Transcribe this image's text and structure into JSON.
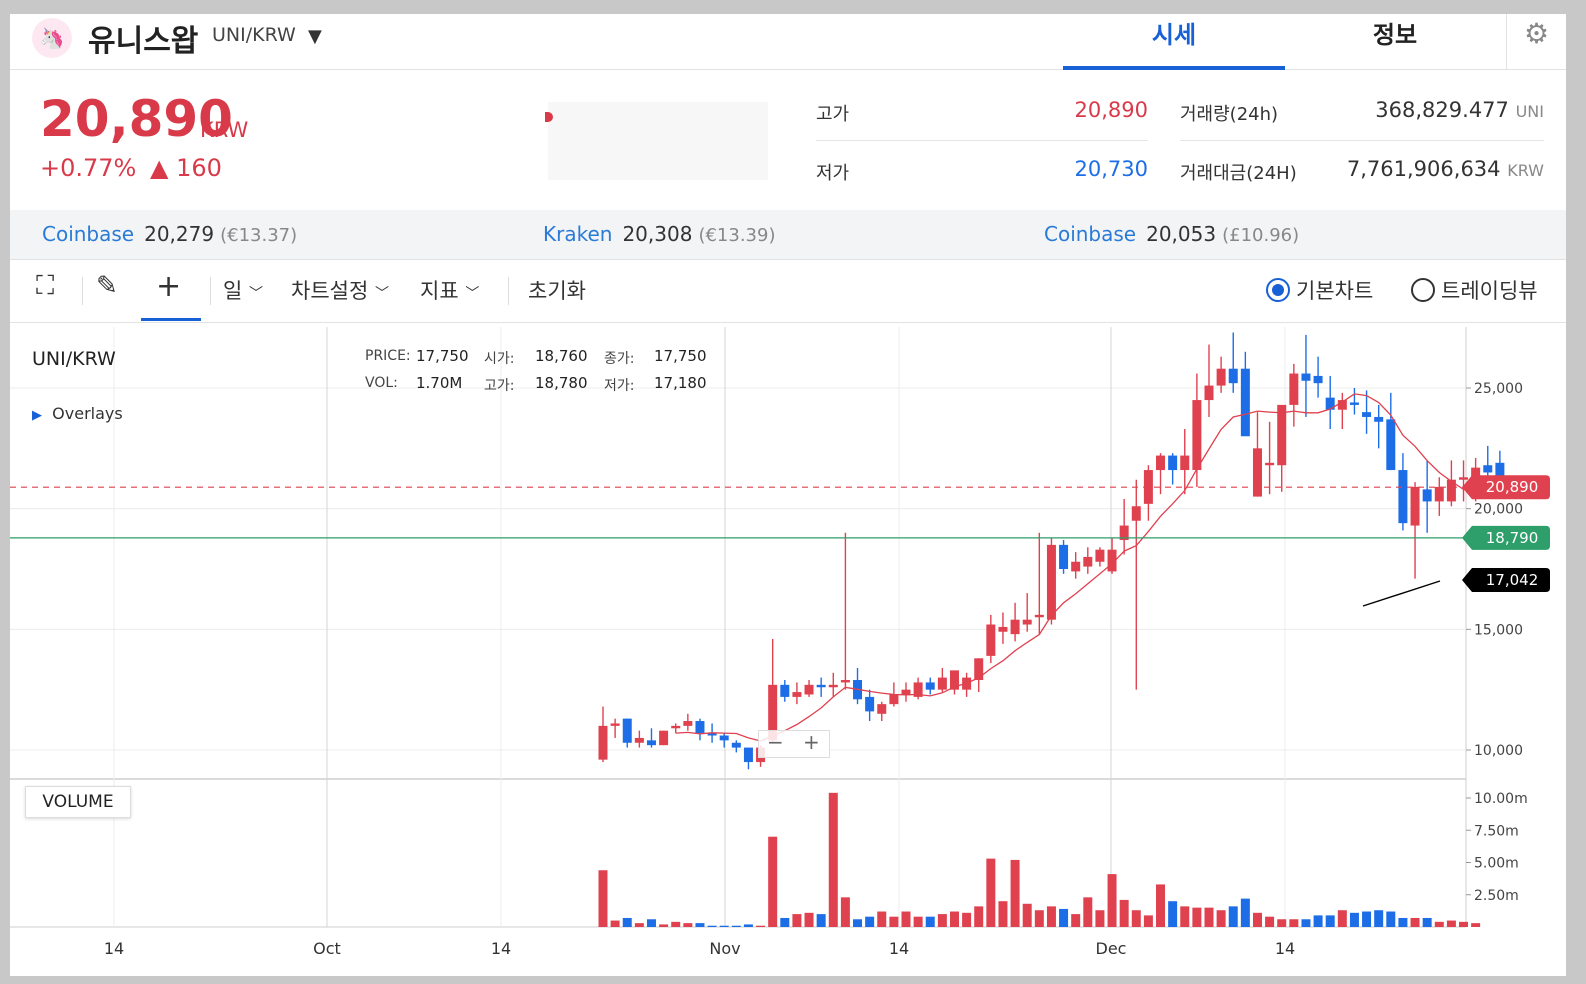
{
  "header": {
    "coin_name": "유니스왑",
    "pair": "UNI/KRW",
    "tabs": [
      {
        "label": "시세"
      },
      {
        "label": "정보"
      }
    ]
  },
  "price": {
    "current": "20,890",
    "currency": "KRW",
    "change_pct": "+0.77%",
    "change_abs": "▲ 160"
  },
  "stats": {
    "high_label": "고가",
    "high_value": "20,890",
    "low_label": "저가",
    "low_value": "20,730",
    "volume_label": "거래량(24h)",
    "volume_value": "368,829.477",
    "volume_unit": "UNI",
    "amount_label": "거래대금(24H)",
    "amount_value": "7,761,906,634",
    "amount_unit": "KRW"
  },
  "exchanges": [
    {
      "name": "Coinbase",
      "price": "20,279",
      "sub": "(€13.37)"
    },
    {
      "name": "Kraken",
      "price": "20,308",
      "sub": "(€13.39)"
    },
    {
      "name": "Coinbase",
      "price": "20,053",
      "sub": "(£10.96)"
    }
  ],
  "toolbar": {
    "period": "일",
    "chart_settings": "차트설정",
    "indicators": "지표",
    "reset": "초기화",
    "basic_chart": "기본차트",
    "tradingview": "트레이딩뷰"
  },
  "chart_info": {
    "symbol": "UNI/KRW",
    "overlays": "Overlays",
    "price_label": "PRICE:",
    "price_value": "17,750",
    "open_label": "시가:",
    "open_value": "18,760",
    "close_label": "종가:",
    "close_value": "17,750",
    "vol_label": "VOL:",
    "vol_value": "1.70M",
    "high_label": "고가:",
    "high_value": "18,780",
    "low_label": "저가:",
    "low_value": "17,180",
    "volume_panel": "VOLUME",
    "zoom_out": "−",
    "zoom_in": "+"
  },
  "colors": {
    "up": "#e0414f",
    "down": "#1d6ee6",
    "accent": "#1760d6",
    "ma": "#e0414f",
    "hline": "#2e9e6a"
  },
  "chart_data": {
    "type": "candlestick",
    "y_ticks": [
      "25,000",
      "20,000",
      "15,000",
      "10,000"
    ],
    "vol_ticks": [
      "10.00m",
      "7.50m",
      "5.00m",
      "2.50m"
    ],
    "x_ticks": [
      "14",
      "Oct",
      "14",
      "Nov",
      "14",
      "Dec",
      "14"
    ],
    "price_lines": [
      {
        "label": "20,890",
        "value": 20890,
        "color": "#e0414f",
        "style": "dashed"
      },
      {
        "label": "18,790",
        "value": 18790,
        "color": "#2e9e6a",
        "style": "solid"
      },
      {
        "label": "17,042",
        "value": 17042,
        "color": "#000000",
        "style": "label"
      }
    ],
    "candles": [
      {
        "o": 9600,
        "h": 11800,
        "l": 9500,
        "c": 11000
      },
      {
        "o": 11000,
        "h": 11300,
        "l": 10500,
        "c": 11100
      },
      {
        "o": 11300,
        "h": 11300,
        "l": 10100,
        "c": 10300
      },
      {
        "o": 10300,
        "h": 10800,
        "l": 10100,
        "c": 10500
      },
      {
        "o": 10400,
        "h": 10900,
        "l": 10100,
        "c": 10200
      },
      {
        "o": 10200,
        "h": 10800,
        "l": 10200,
        "c": 10800
      },
      {
        "o": 10900,
        "h": 11100,
        "l": 10700,
        "c": 11000
      },
      {
        "o": 11000,
        "h": 11500,
        "l": 10800,
        "c": 11200
      },
      {
        "o": 11200,
        "h": 11300,
        "l": 10400,
        "c": 10700
      },
      {
        "o": 10700,
        "h": 11100,
        "l": 10300,
        "c": 10600
      },
      {
        "o": 10600,
        "h": 10700,
        "l": 10100,
        "c": 10400
      },
      {
        "o": 10300,
        "h": 10400,
        "l": 9900,
        "c": 10100
      },
      {
        "o": 10100,
        "h": 10100,
        "l": 9200,
        "c": 9500
      },
      {
        "o": 9500,
        "h": 10200,
        "l": 9300,
        "c": 10100
      },
      {
        "o": 10400,
        "h": 14600,
        "l": 10300,
        "c": 12700
      },
      {
        "o": 12700,
        "h": 12900,
        "l": 12000,
        "c": 12200
      },
      {
        "o": 12200,
        "h": 12800,
        "l": 11900,
        "c": 12400
      },
      {
        "o": 12300,
        "h": 12900,
        "l": 12200,
        "c": 12700
      },
      {
        "o": 12700,
        "h": 13000,
        "l": 12200,
        "c": 12600
      },
      {
        "o": 12600,
        "h": 13200,
        "l": 12200,
        "c": 12700
      },
      {
        "o": 12800,
        "h": 19000,
        "l": 12500,
        "c": 12900
      },
      {
        "o": 12900,
        "h": 13400,
        "l": 11900,
        "c": 12100
      },
      {
        "o": 12200,
        "h": 12500,
        "l": 11200,
        "c": 11600
      },
      {
        "o": 11500,
        "h": 12000,
        "l": 11200,
        "c": 11900
      },
      {
        "o": 11900,
        "h": 12800,
        "l": 11800,
        "c": 12300
      },
      {
        "o": 12300,
        "h": 12800,
        "l": 12000,
        "c": 12500
      },
      {
        "o": 12200,
        "h": 13000,
        "l": 12100,
        "c": 12800
      },
      {
        "o": 12800,
        "h": 13000,
        "l": 12300,
        "c": 12500
      },
      {
        "o": 12500,
        "h": 13400,
        "l": 12400,
        "c": 13000
      },
      {
        "o": 12500,
        "h": 13200,
        "l": 12300,
        "c": 13300
      },
      {
        "o": 12500,
        "h": 13200,
        "l": 12200,
        "c": 13000
      },
      {
        "o": 12900,
        "h": 13800,
        "l": 12400,
        "c": 13800
      },
      {
        "o": 13900,
        "h": 15600,
        "l": 13600,
        "c": 15200
      },
      {
        "o": 14900,
        "h": 15700,
        "l": 14400,
        "c": 15100
      },
      {
        "o": 14800,
        "h": 16100,
        "l": 14500,
        "c": 15400
      },
      {
        "o": 15200,
        "h": 16500,
        "l": 14900,
        "c": 15400
      },
      {
        "o": 15500,
        "h": 19000,
        "l": 14800,
        "c": 15600
      },
      {
        "o": 15400,
        "h": 18800,
        "l": 15200,
        "c": 18500
      },
      {
        "o": 18500,
        "h": 18700,
        "l": 17300,
        "c": 17500
      },
      {
        "o": 17400,
        "h": 18200,
        "l": 17100,
        "c": 17800
      },
      {
        "o": 17600,
        "h": 18400,
        "l": 17300,
        "c": 18000
      },
      {
        "o": 17800,
        "h": 18400,
        "l": 17600,
        "c": 18300
      },
      {
        "o": 17400,
        "h": 18800,
        "l": 17300,
        "c": 18300
      },
      {
        "o": 18700,
        "h": 20400,
        "l": 18100,
        "c": 19300
      },
      {
        "o": 19500,
        "h": 21200,
        "l": 12500,
        "c": 20100
      },
      {
        "o": 20200,
        "h": 21800,
        "l": 19500,
        "c": 21600
      },
      {
        "o": 21600,
        "h": 22300,
        "l": 20600,
        "c": 22200
      },
      {
        "o": 22200,
        "h": 22300,
        "l": 21000,
        "c": 21600
      },
      {
        "o": 21600,
        "h": 23300,
        "l": 20600,
        "c": 22200
      },
      {
        "o": 21600,
        "h": 25600,
        "l": 20900,
        "c": 24500
      },
      {
        "o": 24500,
        "h": 26800,
        "l": 23800,
        "c": 25100
      },
      {
        "o": 25100,
        "h": 26300,
        "l": 24800,
        "c": 25800
      },
      {
        "o": 25800,
        "h": 27300,
        "l": 24800,
        "c": 25200
      },
      {
        "o": 25800,
        "h": 26500,
        "l": 23600,
        "c": 23000
      },
      {
        "o": 20500,
        "h": 24000,
        "l": 20500,
        "c": 22500
      },
      {
        "o": 21800,
        "h": 23600,
        "l": 20600,
        "c": 21900
      },
      {
        "o": 21800,
        "h": 24000,
        "l": 20700,
        "c": 24300
      },
      {
        "o": 24300,
        "h": 26000,
        "l": 23400,
        "c": 25600
      },
      {
        "o": 25600,
        "h": 27200,
        "l": 23800,
        "c": 25300
      },
      {
        "o": 25500,
        "h": 26300,
        "l": 24600,
        "c": 25200
      },
      {
        "o": 24600,
        "h": 25500,
        "l": 23300,
        "c": 24100
      },
      {
        "o": 24100,
        "h": 24800,
        "l": 23300,
        "c": 24500
      },
      {
        "o": 24400,
        "h": 25000,
        "l": 23900,
        "c": 24300
      },
      {
        "o": 24000,
        "h": 24900,
        "l": 23100,
        "c": 23800
      },
      {
        "o": 23800,
        "h": 24300,
        "l": 22500,
        "c": 23600
      },
      {
        "o": 23700,
        "h": 24800,
        "l": 21600,
        "c": 21600
      },
      {
        "o": 21600,
        "h": 22300,
        "l": 19100,
        "c": 19400
      },
      {
        "o": 19300,
        "h": 21100,
        "l": 17100,
        "c": 20900
      },
      {
        "o": 20800,
        "h": 22000,
        "l": 19000,
        "c": 20300
      },
      {
        "o": 20300,
        "h": 21300,
        "l": 19700,
        "c": 20900
      },
      {
        "o": 20300,
        "h": 22000,
        "l": 20100,
        "c": 21200
      },
      {
        "o": 21200,
        "h": 22000,
        "l": 20300,
        "c": 21300
      },
      {
        "o": 21300,
        "h": 22100,
        "l": 20300,
        "c": 21700
      },
      {
        "o": 21800,
        "h": 22600,
        "l": 20900,
        "c": 21500
      },
      {
        "o": 21900,
        "h": 22400,
        "l": 20700,
        "c": 21000
      },
      {
        "o": 20800,
        "h": 20900,
        "l": 20700,
        "c": 20890
      }
    ],
    "volumes_m": [
      4.4,
      0.5,
      0.7,
      0.3,
      0.6,
      0.2,
      0.4,
      0.3,
      0.3,
      0.1,
      0.1,
      0.1,
      0.2,
      0.1,
      7.0,
      0.7,
      1.0,
      1.1,
      1.0,
      10.4,
      2.3,
      0.6,
      0.8,
      1.2,
      0.8,
      1.2,
      0.8,
      0.8,
      1.0,
      1.2,
      1.1,
      1.6,
      5.3,
      2.0,
      5.2,
      1.8,
      1.3,
      1.6,
      1.4,
      1.0,
      2.3,
      1.3,
      4.1,
      2.1,
      1.3,
      0.9,
      3.3,
      2.0,
      1.6,
      1.5,
      1.5,
      1.3,
      1.6,
      2.2,
      1.1,
      0.8,
      0.6,
      0.6,
      0.6,
      0.9,
      0.9,
      1.3,
      1.1,
      1.2,
      1.3,
      1.2,
      0.7,
      0.7,
      0.7,
      0.4,
      0.5,
      0.4,
      0.3
    ]
  }
}
